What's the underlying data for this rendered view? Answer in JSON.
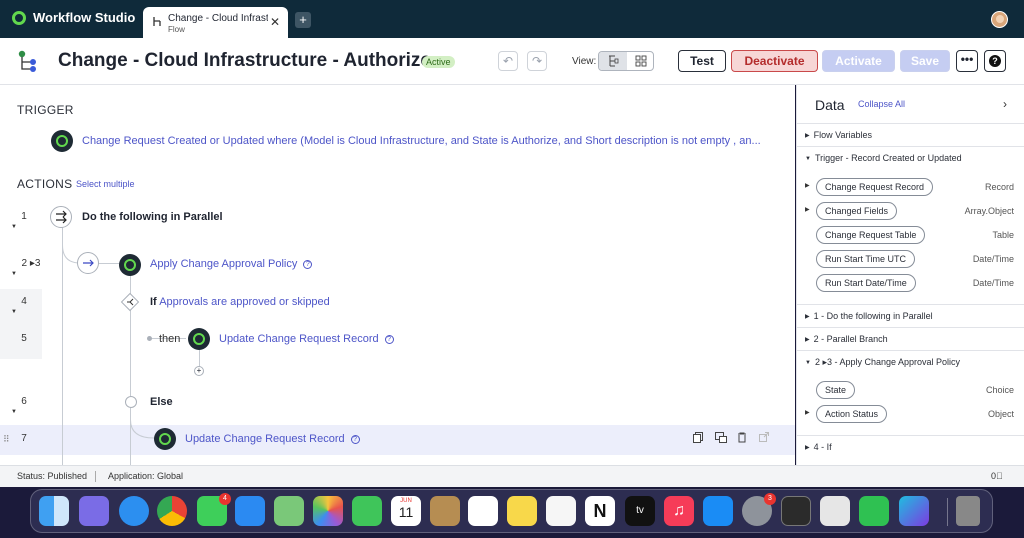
{
  "app": {
    "name": "Workflow Studio"
  },
  "tab": {
    "title": "Change - Cloud Infrastructure - Authorize",
    "subtitle": "Flow",
    "add_label": "+"
  },
  "header": {
    "title": "Change - Cloud Infrastructure - Authorize",
    "status": "Active",
    "view_label": "View:",
    "buttons": {
      "test": "Test",
      "deactivate": "Deactivate",
      "activate": "Activate",
      "save": "Save",
      "more": "•••",
      "help": "?"
    }
  },
  "trigger": {
    "heading": "TRIGGER",
    "text": "Change Request Created or Updated where (Model is Cloud Infrastructure, and State is Authorize, and Short description is not empty , an..."
  },
  "actions": {
    "heading": "ACTIONS",
    "select_multiple": "Select multiple",
    "rows": [
      {
        "num": "1",
        "label": "Do the following in Parallel"
      },
      {
        "num": "2 ▸3",
        "label": "Apply Change Approval Policy"
      },
      {
        "num": "4",
        "keyword": "If",
        "label": "Approvals are approved or skipped"
      },
      {
        "num": "5",
        "keyword": "then",
        "label": "Update Change Request Record"
      },
      {
        "num": "6",
        "label": "Else"
      },
      {
        "num": "7",
        "label": "Update Change Request Record"
      }
    ]
  },
  "panel": {
    "title": "Data",
    "collapse_all": "Collapse All",
    "sections": [
      {
        "label": "Flow Variables",
        "expanded": false
      },
      {
        "label": "Trigger - Record Created or Updated",
        "expanded": true
      },
      {
        "label": "1 - Do the following in Parallel",
        "expanded": false
      },
      {
        "label": "2 - Parallel Branch",
        "expanded": false
      },
      {
        "label": "2 ▸3 - Apply Change Approval Policy",
        "expanded": true
      },
      {
        "label": "4 - If",
        "expanded": false
      }
    ],
    "trigger_pills": [
      {
        "label": "Change Request Record",
        "type": "Record"
      },
      {
        "label": "Changed Fields",
        "type": "Array.Object"
      },
      {
        "label": "Change Request Table",
        "type": "Table"
      },
      {
        "label": "Run Start Time UTC",
        "type": "Date/Time"
      },
      {
        "label": "Run Start Date/Time",
        "type": "Date/Time"
      }
    ],
    "policy_pills": [
      {
        "label": "State",
        "type": "Choice"
      },
      {
        "label": "Action Status",
        "type": "Object"
      }
    ]
  },
  "statusbar": {
    "status": "Status: Published",
    "application": "Application: Global",
    "right": "0⃤"
  },
  "dock": {
    "calendar": {
      "month": "JUN",
      "day": "11"
    },
    "badges": {
      "messages": "4",
      "settings": "3"
    },
    "tv_label": "tv"
  },
  "colors": {
    "accent": "#4d55c8",
    "danger": "#b42c2c",
    "brand_green": "#62d84e",
    "appbar": "#0f2a3a"
  }
}
